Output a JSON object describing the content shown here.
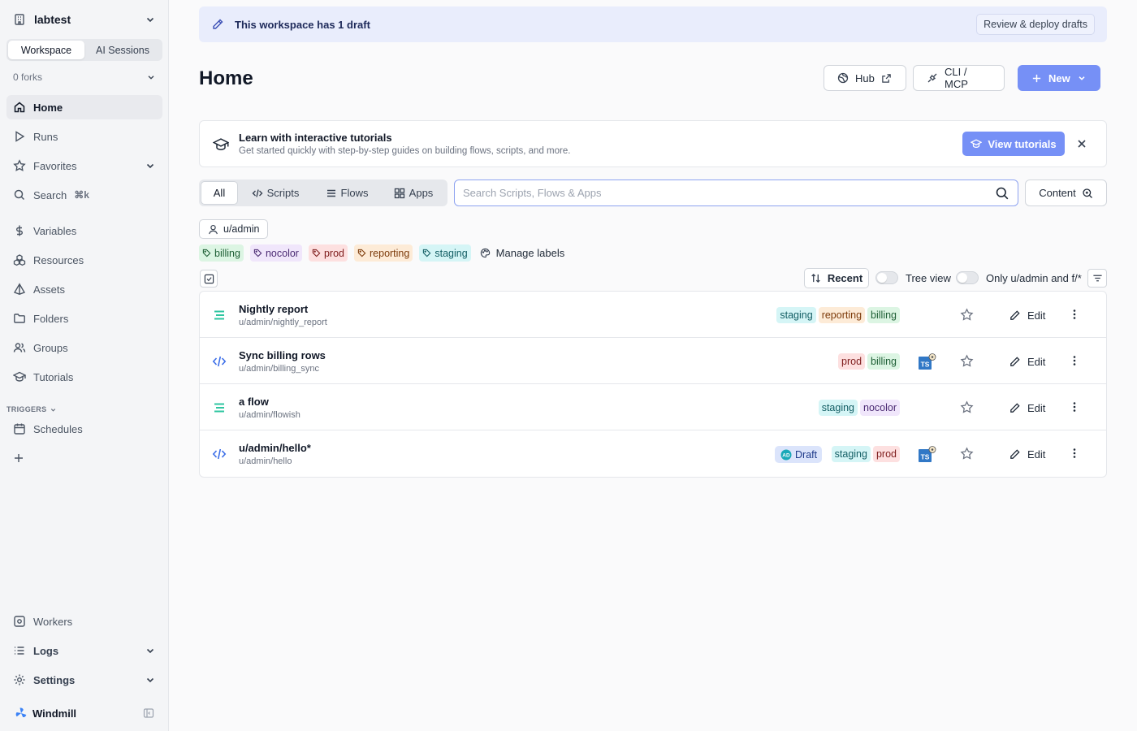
{
  "sidebar": {
    "workspace": "labtest",
    "seg_workspace": "Workspace",
    "seg_ai": "AI Sessions",
    "forks": "0 forks",
    "nav": {
      "home": "Home",
      "runs": "Runs",
      "favorites": "Favorites",
      "search": "Search",
      "search_kbd": "⌘k",
      "variables": "Variables",
      "resources": "Resources",
      "assets": "Assets",
      "folders": "Folders",
      "groups": "Groups",
      "tutorials": "Tutorials"
    },
    "triggers_label": "TRIGGERS",
    "schedules": "Schedules",
    "workers": "Workers",
    "logs": "Logs",
    "settings": "Settings",
    "brand": "Windmill"
  },
  "banner": {
    "text": "This workspace has 1 draft",
    "button": "Review & deploy drafts"
  },
  "header": {
    "title": "Home",
    "hub": "Hub",
    "cli": "CLI / MCP",
    "new": "New"
  },
  "tutorial": {
    "title": "Learn with interactive tutorials",
    "subtitle": "Get started quickly with step-by-step guides on building flows, scripts, and more.",
    "button": "View tutorials"
  },
  "filters": {
    "tabs": [
      "All",
      "Scripts",
      "Flows",
      "Apps"
    ],
    "search_placeholder": "Search Scripts, Flows & Apps",
    "search_value": "",
    "content_button": "Content",
    "owner": "u/admin",
    "labels": [
      "billing",
      "nocolor",
      "prod",
      "reporting",
      "staging"
    ],
    "manage_labels": "Manage labels",
    "sort": "Recent",
    "tree_view": "Tree view",
    "only_mine": "Only u/admin and f/*"
  },
  "items": [
    {
      "kind": "flow",
      "name": "Nightly report",
      "path": "u/admin/nightly_report",
      "tags": [
        "staging",
        "reporting",
        "billing"
      ],
      "ts": false,
      "draft": "",
      "edit": "Edit"
    },
    {
      "kind": "script",
      "name": "Sync billing rows",
      "path": "u/admin/billing_sync",
      "tags": [
        "prod",
        "billing"
      ],
      "ts": true,
      "ts_label": "TS",
      "draft": "",
      "edit": "Edit"
    },
    {
      "kind": "flow",
      "name": "a flow",
      "path": "u/admin/flowish",
      "tags": [
        "staging",
        "nocolor"
      ],
      "ts": false,
      "draft": "",
      "edit": "Edit"
    },
    {
      "kind": "script",
      "name": "u/admin/hello*",
      "path": "u/admin/hello",
      "tags": [
        "staging",
        "prod"
      ],
      "ts": true,
      "ts_label": "TS",
      "draft": "Draft",
      "draft_avatar": "AD",
      "edit": "Edit"
    }
  ],
  "colors": {
    "accent": "#7690f6",
    "banner_bg": "#e9edfc",
    "billing": "#dcf5e3",
    "nocolor": "#f0e6fb",
    "prod": "#fde0e0",
    "reporting": "#fdebd7",
    "staging": "#d5f5f6",
    "flow_icon": "#2fc6a1",
    "script_icon": "#3b6ee8"
  }
}
